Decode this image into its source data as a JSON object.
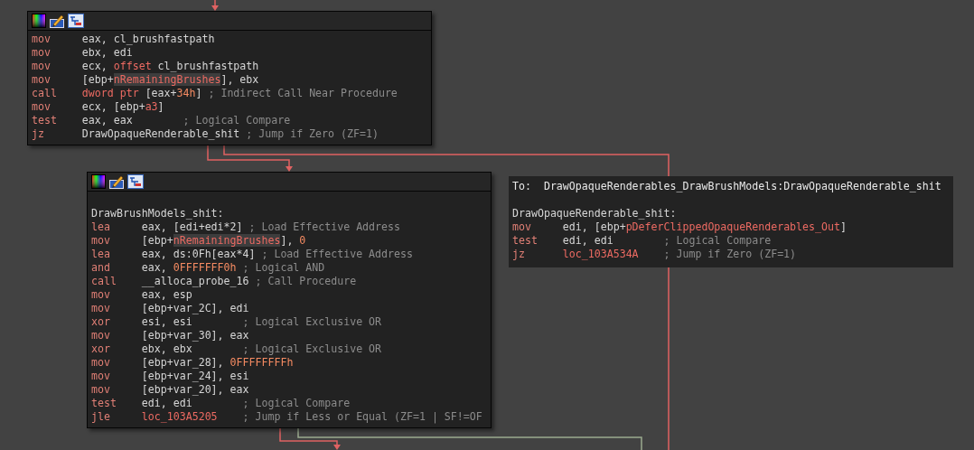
{
  "nodes": [
    {
      "kind": "block",
      "lines": [
        {
          "kind": "instr",
          "mnemonic": "mov",
          "operands": [
            {
              "text": "eax, cl_brushfastpath",
              "kind": "plain"
            }
          ]
        },
        {
          "kind": "instr",
          "mnemonic": "mov",
          "operands": [
            {
              "text": "ebx, edi",
              "kind": "plain"
            }
          ]
        },
        {
          "kind": "instr",
          "mnemonic": "mov",
          "operands": [
            {
              "text": "ecx, ",
              "kind": "plain"
            },
            {
              "text": "offset",
              "kind": "keyword"
            },
            {
              "text": " cl_brushfastpath",
              "kind": "plain"
            }
          ]
        },
        {
          "kind": "instr",
          "mnemonic": "mov",
          "operands": [
            {
              "text": "[ebp+",
              "kind": "plain"
            },
            {
              "text": "nRemainingBrushes",
              "kind": "highlight"
            },
            {
              "text": "], ebx",
              "kind": "plain"
            }
          ]
        },
        {
          "kind": "instr",
          "mnemonic": "call",
          "operands": [
            {
              "text": "dword ptr",
              "kind": "keyword"
            },
            {
              "text": " [eax+",
              "kind": "plain"
            },
            {
              "text": "34h",
              "kind": "number"
            },
            {
              "text": "]",
              "kind": "plain"
            }
          ],
          "comment": "; Indirect Call Near Procedure"
        },
        {
          "kind": "instr",
          "mnemonic": "mov",
          "operands": [
            {
              "text": "ecx, [ebp+",
              "kind": "plain"
            },
            {
              "text": "a3",
              "kind": "keyword"
            },
            {
              "text": "]",
              "kind": "plain"
            }
          ]
        },
        {
          "kind": "instr",
          "mnemonic": "test",
          "operands": [
            {
              "text": "eax, eax",
              "kind": "plain"
            }
          ],
          "comment": "; Logical Compare"
        },
        {
          "kind": "instr",
          "mnemonic": "jz",
          "operands": [
            {
              "text": "DrawOpaqueRenderable_shit",
              "kind": "plain"
            }
          ],
          "comment": "; Jump if Zero (ZF=1)"
        }
      ]
    },
    {
      "kind": "block",
      "lines": [
        {
          "kind": "blank"
        },
        {
          "kind": "label",
          "text": "DrawBrushModels_shit:"
        },
        {
          "kind": "instr",
          "mnemonic": "lea",
          "operands": [
            {
              "text": "eax, [edi+edi*2]",
              "kind": "plain"
            }
          ],
          "comment": "; Load Effective Address"
        },
        {
          "kind": "instr",
          "mnemonic": "mov",
          "operands": [
            {
              "text": "[ebp+",
              "kind": "plain"
            },
            {
              "text": "nRemainingBrushes",
              "kind": "highlight"
            },
            {
              "text": "], ",
              "kind": "plain"
            },
            {
              "text": "0",
              "kind": "number"
            }
          ]
        },
        {
          "kind": "instr",
          "mnemonic": "lea",
          "operands": [
            {
              "text": "eax, ds:0Fh[eax*4]",
              "kind": "plain"
            }
          ],
          "comment": "; Load Effective Address"
        },
        {
          "kind": "instr",
          "mnemonic": "and",
          "operands": [
            {
              "text": "eax, ",
              "kind": "plain"
            },
            {
              "text": "0FFFFFFF0h",
              "kind": "number"
            }
          ],
          "comment": "; Logical AND"
        },
        {
          "kind": "instr",
          "mnemonic": "call",
          "operands": [
            {
              "text": "__alloca_probe_16",
              "kind": "plain"
            }
          ],
          "comment": "; Call Procedure"
        },
        {
          "kind": "instr",
          "mnemonic": "mov",
          "operands": [
            {
              "text": "eax, esp",
              "kind": "plain"
            }
          ]
        },
        {
          "kind": "instr",
          "mnemonic": "mov",
          "operands": [
            {
              "text": "[ebp+var_2C], edi",
              "kind": "plain"
            }
          ]
        },
        {
          "kind": "instr",
          "mnemonic": "xor",
          "operands": [
            {
              "text": "esi, esi",
              "kind": "plain"
            }
          ],
          "comment": "; Logical Exclusive OR"
        },
        {
          "kind": "instr",
          "mnemonic": "mov",
          "operands": [
            {
              "text": "[ebp+var_30], eax",
              "kind": "plain"
            }
          ]
        },
        {
          "kind": "instr",
          "mnemonic": "xor",
          "operands": [
            {
              "text": "ebx, ebx",
              "kind": "plain"
            }
          ],
          "comment": "; Logical Exclusive OR"
        },
        {
          "kind": "instr",
          "mnemonic": "mov",
          "operands": [
            {
              "text": "[ebp+var_28], ",
              "kind": "plain"
            },
            {
              "text": "0FFFFFFFFh",
              "kind": "number"
            }
          ]
        },
        {
          "kind": "instr",
          "mnemonic": "mov",
          "operands": [
            {
              "text": "[ebp+var_24], esi",
              "kind": "plain"
            }
          ]
        },
        {
          "kind": "instr",
          "mnemonic": "mov",
          "operands": [
            {
              "text": "[ebp+var_20], eax",
              "kind": "plain"
            }
          ]
        },
        {
          "kind": "instr",
          "mnemonic": "test",
          "operands": [
            {
              "text": "edi, edi",
              "kind": "plain"
            }
          ],
          "comment": "; Logical Compare"
        },
        {
          "kind": "instr",
          "mnemonic": "jle",
          "operands": [
            {
              "text": "loc_103A5205",
              "kind": "keyword"
            }
          ],
          "comment": "; Jump if Less or Equal (ZF=1 | SF!=OF"
        }
      ]
    },
    {
      "kind": "hint",
      "lines": [
        {
          "kind": "title",
          "text": "To:  DrawOpaqueRenderables_DrawBrushModels:DrawOpaqueRenderable_shit"
        },
        {
          "kind": "blank"
        },
        {
          "kind": "label",
          "text": "DrawOpaqueRenderable_shit:"
        },
        {
          "kind": "instr",
          "mnemonic": "mov",
          "operands": [
            {
              "text": "edi, [ebp+",
              "kind": "plain"
            },
            {
              "text": "pDeferClippedOpaqueRenderables_Out",
              "kind": "keyword"
            },
            {
              "text": "]",
              "kind": "plain"
            }
          ]
        },
        {
          "kind": "instr",
          "mnemonic": "test",
          "operands": [
            {
              "text": "edi, edi",
              "kind": "plain"
            }
          ],
          "comment": "; Logical Compare"
        },
        {
          "kind": "instr",
          "mnemonic": "jz",
          "operands": [
            {
              "text": "loc_103A534A",
              "kind": "keyword"
            }
          ],
          "comment": "; Jump if Zero (ZF=1)"
        }
      ]
    }
  ]
}
